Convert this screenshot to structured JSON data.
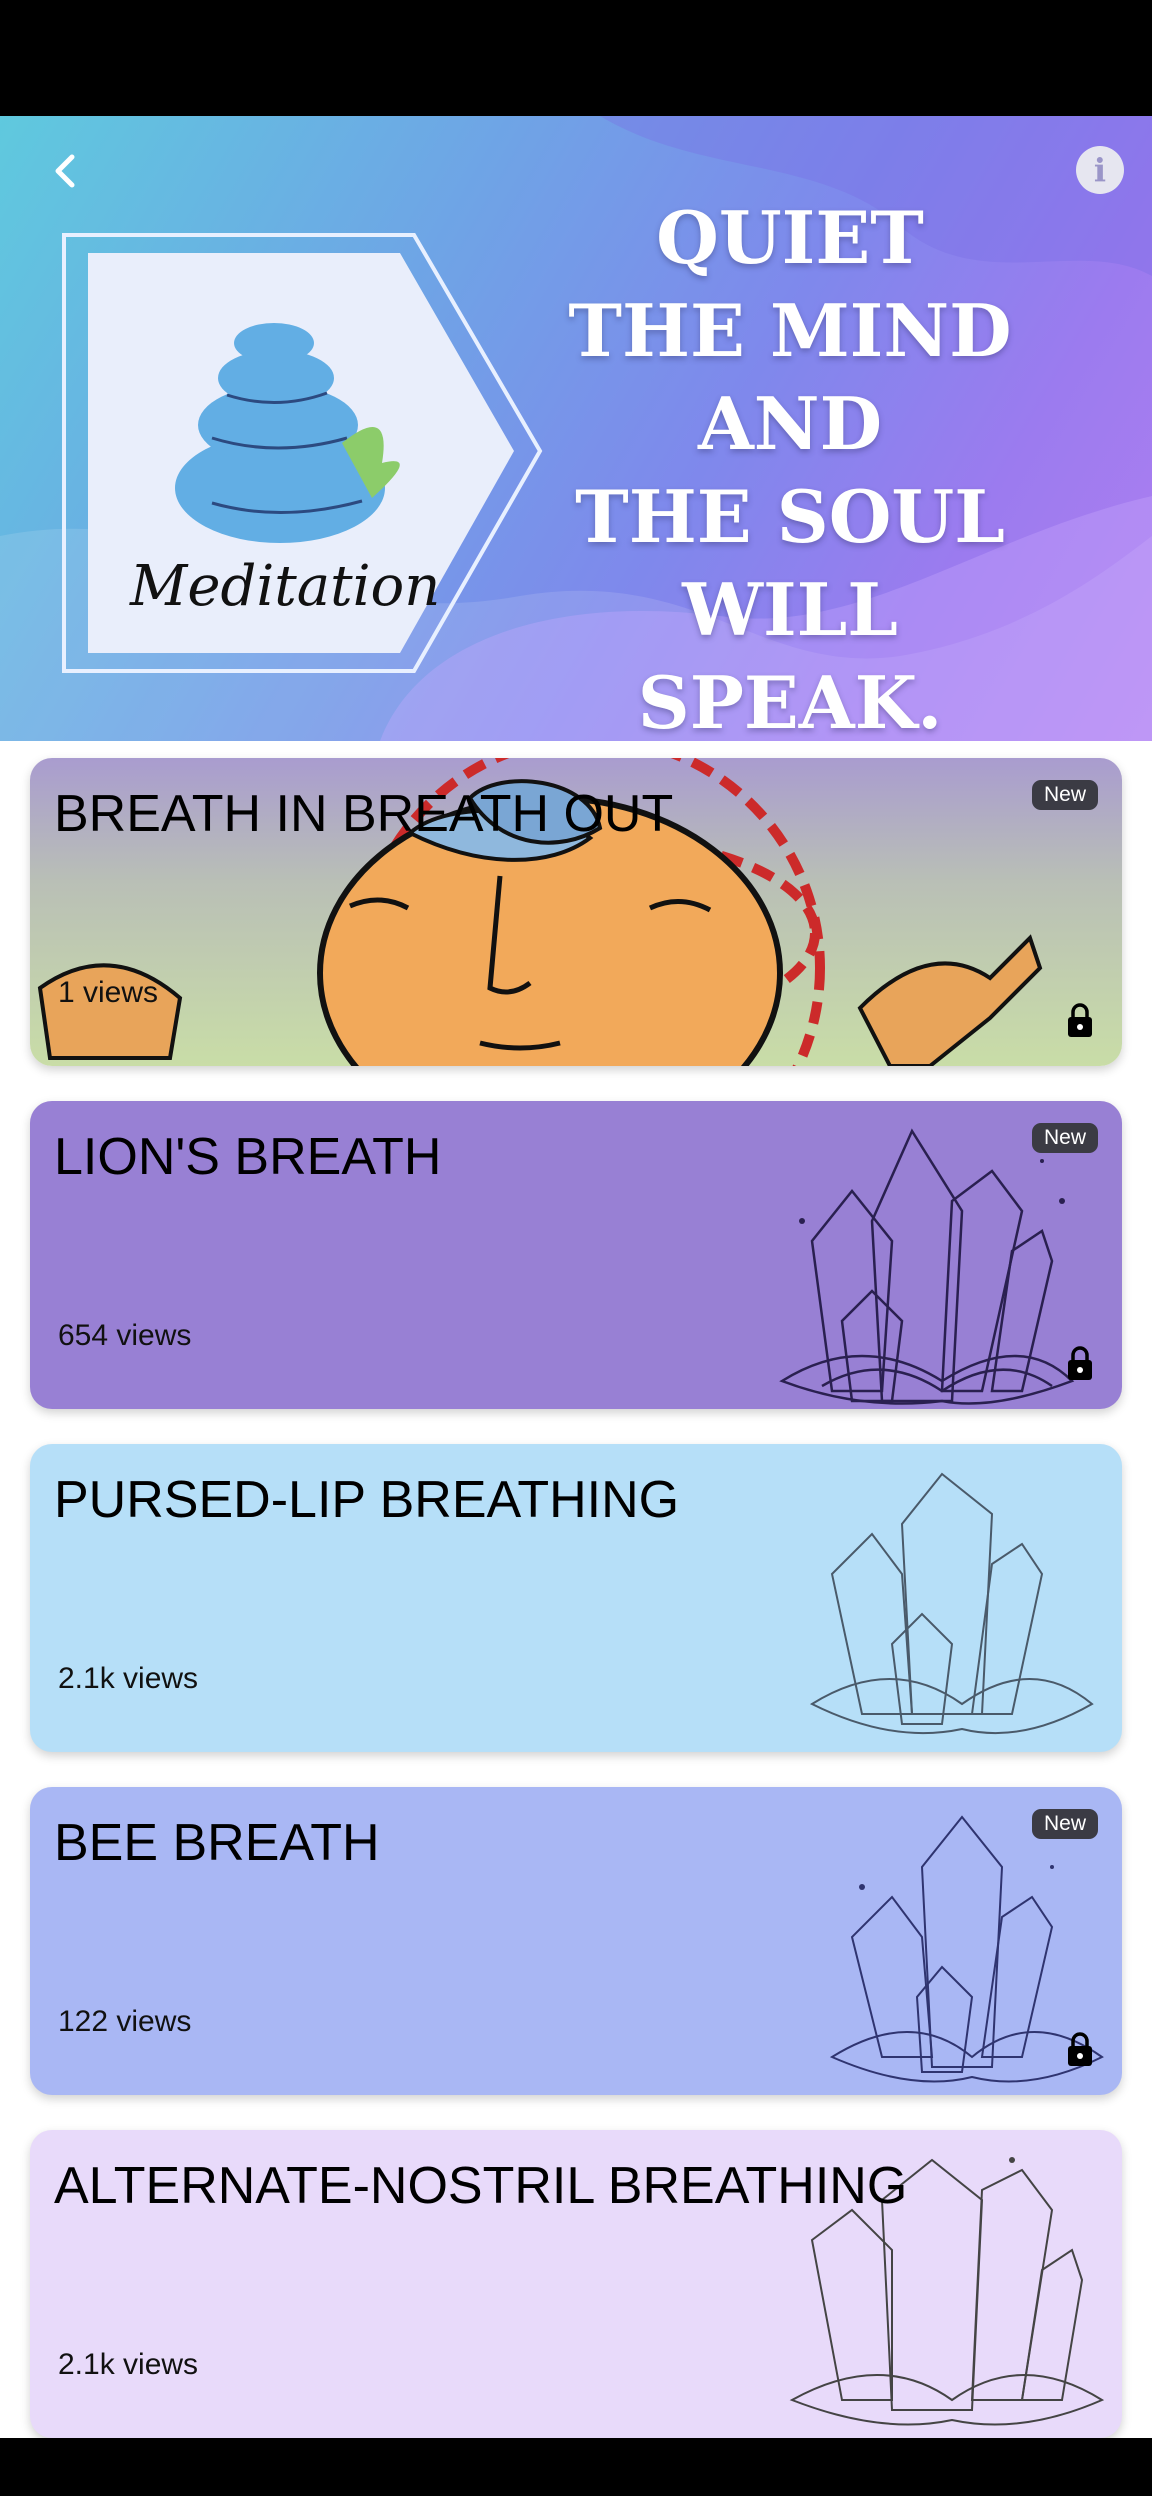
{
  "header": {
    "back_icon": "chevron-left-icon",
    "info_icon": "info-icon",
    "info_label": "i",
    "logo_text": "Meditation",
    "quote": "QUIET\nTHE MIND\nAND\nTHE SOUL\nWILL SPEAK."
  },
  "cards": [
    {
      "title": "BREATH IN BREATH OUT",
      "views": "1 views",
      "badge": "New",
      "locked": true,
      "color": "#c8d8a8"
    },
    {
      "title": "LION'S BREATH",
      "views": "654 views",
      "badge": "New",
      "locked": true,
      "color": "#9880d4"
    },
    {
      "title": "PURSED-LIP BREATHING",
      "views": "2.1k views",
      "badge": "",
      "locked": false,
      "color": "#b6dff8"
    },
    {
      "title": "BEE BREATH",
      "views": "122 views",
      "badge": "New",
      "locked": true,
      "color": "#a9b7f4"
    },
    {
      "title": "ALTERNATE-NOSTRIL BREATHING",
      "views": "2.1k views",
      "badge": "",
      "locked": false,
      "color": "#e8dafa"
    }
  ],
  "colors": {
    "hero_start": "#5fc9de",
    "hero_end": "#b07ff0",
    "badge_bg": "#3b3b44"
  }
}
